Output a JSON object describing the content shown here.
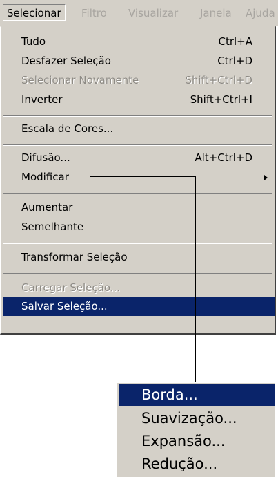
{
  "menubar": {
    "items": [
      {
        "label": "Selecionar",
        "active": true
      },
      {
        "label": "Filtro",
        "active": false
      },
      {
        "label": "Visualizar",
        "active": false
      },
      {
        "label": "Janela",
        "active": false
      },
      {
        "label": "Ajuda",
        "active": false
      }
    ]
  },
  "menu": {
    "items": [
      {
        "label": "Tudo",
        "shortcut": "Ctrl+A",
        "state": "enabled"
      },
      {
        "label": "Desfazer Seleção",
        "shortcut": "Ctrl+D",
        "state": "enabled"
      },
      {
        "label": "Selecionar Novamente",
        "shortcut": "Shift+Ctrl+D",
        "state": "disabled"
      },
      {
        "label": "Inverter",
        "shortcut": "Shift+Ctrl+I",
        "state": "enabled"
      },
      {
        "label": "Escala de Cores...",
        "shortcut": "",
        "state": "enabled"
      },
      {
        "label": "Difusão...",
        "shortcut": "Alt+Ctrl+D",
        "state": "enabled"
      },
      {
        "label": "Modificar",
        "shortcut": "",
        "state": "enabled",
        "submenu": true
      },
      {
        "label": "Aumentar",
        "shortcut": "",
        "state": "enabled"
      },
      {
        "label": "Semelhante",
        "shortcut": "",
        "state": "enabled"
      },
      {
        "label": "Transformar Seleção",
        "shortcut": "",
        "state": "enabled"
      },
      {
        "label": "Carregar Seleção...",
        "shortcut": "",
        "state": "disabled"
      },
      {
        "label": "Salvar Seleção...",
        "shortcut": "",
        "state": "highlighted"
      }
    ]
  },
  "submenu": {
    "items": [
      {
        "label": "Borda...",
        "state": "highlighted"
      },
      {
        "label": "Suavização...",
        "state": "enabled"
      },
      {
        "label": "Expansão...",
        "state": "enabled"
      },
      {
        "label": "Redução...",
        "state": "enabled"
      }
    ]
  },
  "colors": {
    "menu_background": "#d4d0c8",
    "highlight": "#0a246a",
    "highlight_text": "#ffffff",
    "disabled_text": "#8e8b85"
  }
}
